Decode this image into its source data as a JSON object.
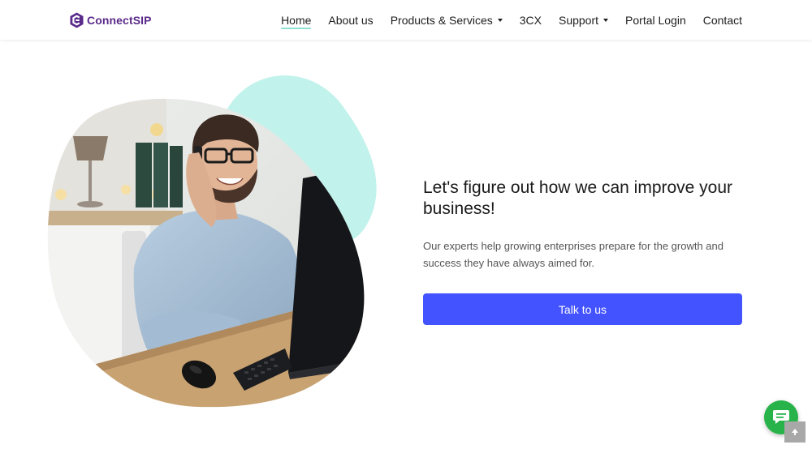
{
  "brand": {
    "name": "ConnectSIP",
    "color": "#5a2a8a"
  },
  "nav": {
    "home": "Home",
    "about": "About us",
    "products": "Products & Services",
    "threecx": "3CX",
    "support": "Support",
    "portal": "Portal Login",
    "contact": "Contact",
    "active": "Home"
  },
  "hero": {
    "headline": "Let's figure out how we can improve your business!",
    "subtext": "Our experts help growing enterprises prepare for the growth and success they have always aimed for.",
    "cta_label": "Talk to us"
  },
  "widgets": {
    "chat_icon": "chat-bubble-icon",
    "scroll_top_icon": "arrow-up-icon"
  },
  "colors": {
    "accent": "#4353ff",
    "mint": "#c1f2ec",
    "chat": "#27b34a",
    "nav_underline": "#8ee0d3"
  }
}
